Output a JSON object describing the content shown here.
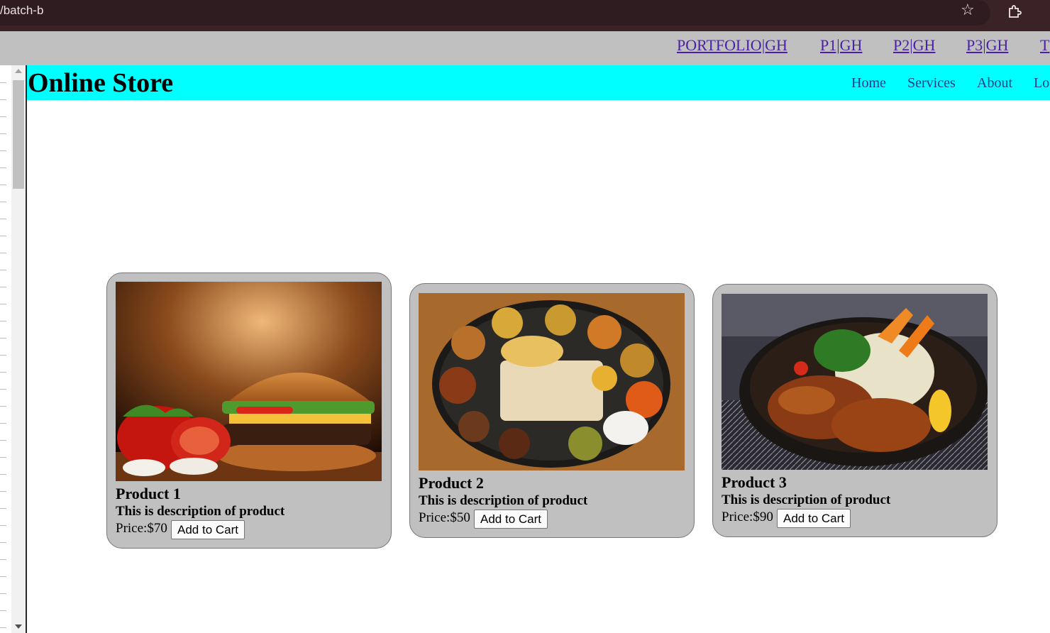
{
  "browser": {
    "url": "/batch-b",
    "star_icon": "star-icon",
    "extensions_icon": "puzzle-icon"
  },
  "portfolio_links": [
    "PORTFOLIO|GH",
    "P1|GH",
    "P2|GH",
    "P3|GH",
    "T"
  ],
  "header": {
    "title": "Online Store",
    "nav": [
      "Home",
      "Services",
      "About",
      "Lo"
    ],
    "background": "#00ffff"
  },
  "products": [
    {
      "name": "Product 1",
      "description": "This is description of product",
      "price": "Price:$70",
      "button": "Add to Cart",
      "image": "burger-image"
    },
    {
      "name": "Product 2",
      "description": "This is description of product",
      "price": "Price:$50",
      "button": "Add to Cart",
      "image": "thali-image"
    },
    {
      "name": "Product 3",
      "description": "This is description of product",
      "price": "Price:$90",
      "button": "Add to Cart",
      "image": "chicken-bowl-image"
    }
  ],
  "colors": {
    "card_bg": "#c0c0c0",
    "portfolio_bar": "#c0c0c0",
    "link": "#4b1fa6",
    "nav_link": "#1a3a8f"
  }
}
